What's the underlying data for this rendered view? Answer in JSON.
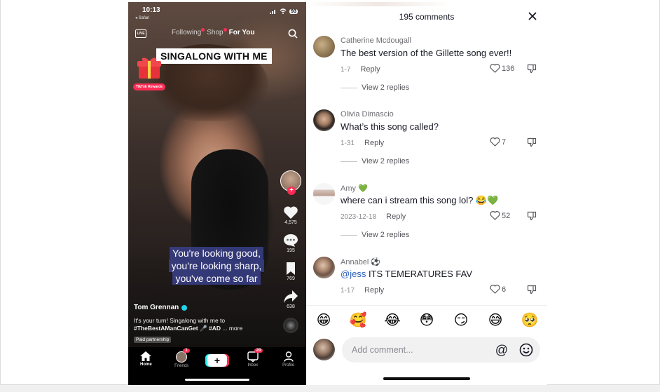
{
  "status_bar": {
    "time": "10:13",
    "back_app": "◂ Safari",
    "battery": "93"
  },
  "top_nav": {
    "live_label": "LIVE",
    "tabs": [
      {
        "label": "Following",
        "active": false,
        "dot": true
      },
      {
        "label": "Shop",
        "active": false,
        "dot": true
      },
      {
        "label": "For You",
        "active": true,
        "dot": false
      }
    ]
  },
  "video": {
    "banner": "SINGALONG WITH ME",
    "rewards_label": "TikTok Rewards",
    "caption_lines": [
      "You're looking good,",
      "you're looking sharp,",
      "you've come so far"
    ],
    "likes": "4,575",
    "comments": "195",
    "saves": "769",
    "shares": "638",
    "author": "Tom Grennan",
    "description_line1": "It's your turn! Singalong with me to",
    "description_hashtags": "#TheBestAManCanGet",
    "description_tag2": "#AD",
    "description_more": "... more",
    "paid_label": "Paid partnership"
  },
  "tabbar": {
    "items": [
      {
        "label": "Home",
        "active": true
      },
      {
        "label": "Friends",
        "badge": "1"
      },
      {
        "label": ""
      },
      {
        "label": "Inbox",
        "badge": "20"
      },
      {
        "label": "Profile"
      }
    ]
  },
  "comments_panel": {
    "title": "195 comments",
    "comments": [
      {
        "name": "Catherine Mcdougall",
        "text": "The best version of the Gillette song ever!!",
        "date": "1-7",
        "reply": "Reply",
        "likes": "136",
        "view_replies": "View 2 replies"
      },
      {
        "name": "Olivia Dimascio",
        "text": "What’s this song called?",
        "date": "1-31",
        "reply": "Reply",
        "likes": "7",
        "view_replies": "View 2 replies"
      },
      {
        "name": "Amy 💚",
        "text": "where can i stream this song lol? 😂💚",
        "date": "2023-12-18",
        "reply": "Reply",
        "likes": "52",
        "view_replies": "View 2 replies"
      },
      {
        "name": "Annabel ⚽",
        "mention": "@jess",
        "text": " ITS TEMERATURES FAV",
        "date": "1-17",
        "reply": "Reply",
        "likes": "6"
      }
    ],
    "quick_emojis": [
      "😁",
      "🥰",
      "😂",
      "😳",
      "😏",
      "😅",
      "🥺"
    ],
    "input_placeholder": "Add comment...",
    "at_symbol": "@"
  }
}
